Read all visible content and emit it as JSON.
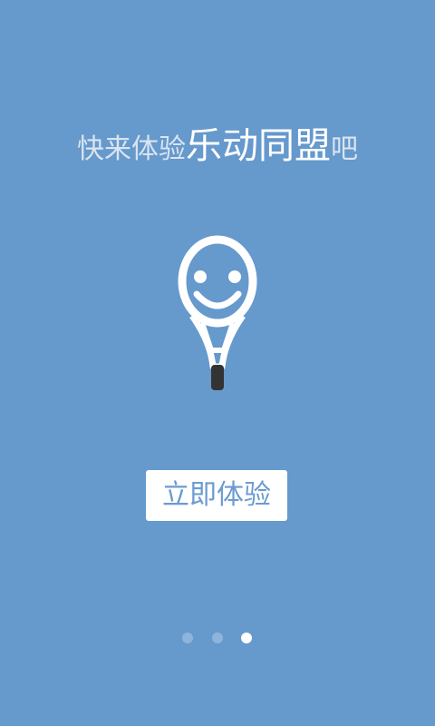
{
  "splash": {
    "headline_prefix": "快来体验",
    "headline_brand": "乐动同盟",
    "headline_suffix": "吧",
    "logo_icon": "smiling-tennis-racket-icon",
    "cta_label": "立即体验"
  },
  "pager": {
    "total_pages": 3,
    "current_page": 3
  },
  "colors": {
    "background": "#6699cc",
    "button_text": "#6b9bd0",
    "handle": "#333333"
  }
}
